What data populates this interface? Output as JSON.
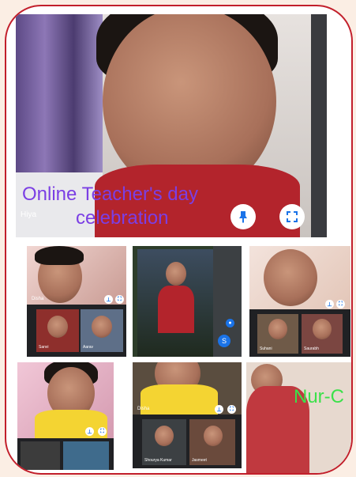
{
  "main_video": {
    "participant_name": "Hiya",
    "overlay_line1": "Online Teacher's day",
    "overlay_line2": "celebration",
    "pin_icon": "pin-icon",
    "fullscreen_icon": "fullscreen-icon",
    "accent": "#1a73e8"
  },
  "grid_tiles": [
    {
      "name": "Disha",
      "thumbs": [
        "Sanvi",
        "Aarav"
      ]
    },
    {
      "name": "",
      "badge": "S"
    },
    {
      "name": "",
      "thumbs": [
        "Suhani",
        "Saurabh"
      ]
    },
    {
      "name": ""
    },
    {
      "name": "Disha",
      "thumbs": [
        "Shourya Kumar",
        "Jasmeet"
      ]
    },
    {
      "label": "Nur-C"
    }
  ],
  "colors": {
    "frame_border": "#c21f2b",
    "overlay_text": "#7b3fe4",
    "nurc_text": "#3be14a"
  }
}
